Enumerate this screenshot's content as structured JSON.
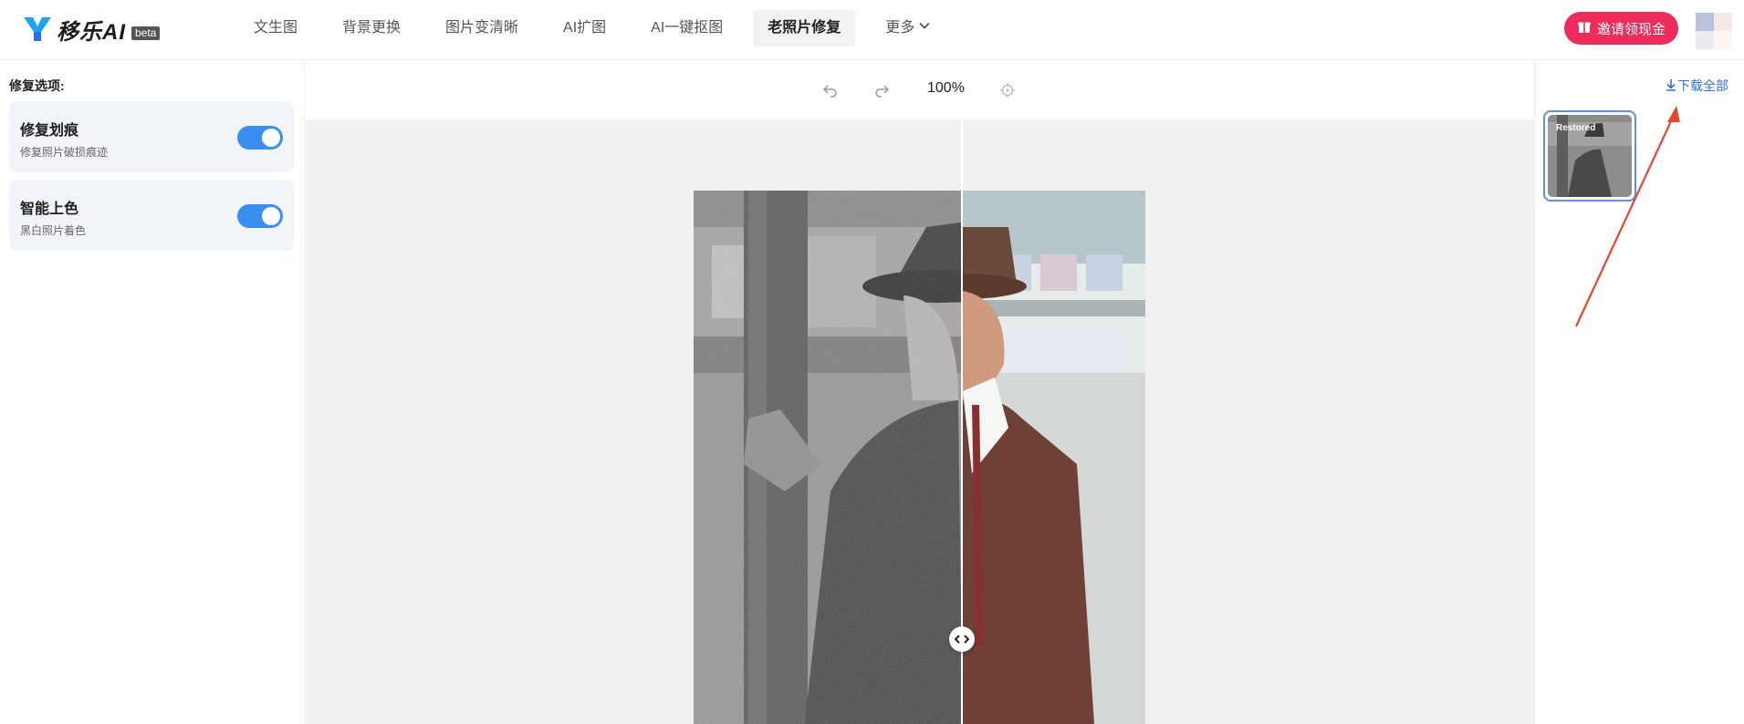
{
  "app": {
    "name": "移乐AI",
    "badge": "beta"
  },
  "nav": {
    "items": [
      {
        "label": "文生图"
      },
      {
        "label": "背景更换"
      },
      {
        "label": "图片变清晰"
      },
      {
        "label": "AI扩图"
      },
      {
        "label": "AI一键抠图"
      },
      {
        "label": "老照片修复"
      }
    ],
    "more_label": "更多",
    "active_index": 5
  },
  "header": {
    "invite_label": "邀请领现金"
  },
  "left_panel": {
    "title": "修复选项:",
    "options": [
      {
        "title": "修复划痕",
        "description": "修复照片破损痕迹",
        "enabled": true
      },
      {
        "title": "智能上色",
        "description": "黑白照片着色",
        "enabled": true
      }
    ]
  },
  "toolbar": {
    "zoom": "100%",
    "icons": [
      "undo-icon",
      "redo-icon",
      "target-icon"
    ]
  },
  "right_panel": {
    "download_all_label": "下载全部",
    "thumbnail_label": "Restored"
  },
  "colors": {
    "accent": "#3a8ef0",
    "invite": "#ee2b5a",
    "link": "#2f6fe0",
    "annotation_arrow": "#e8452c"
  }
}
